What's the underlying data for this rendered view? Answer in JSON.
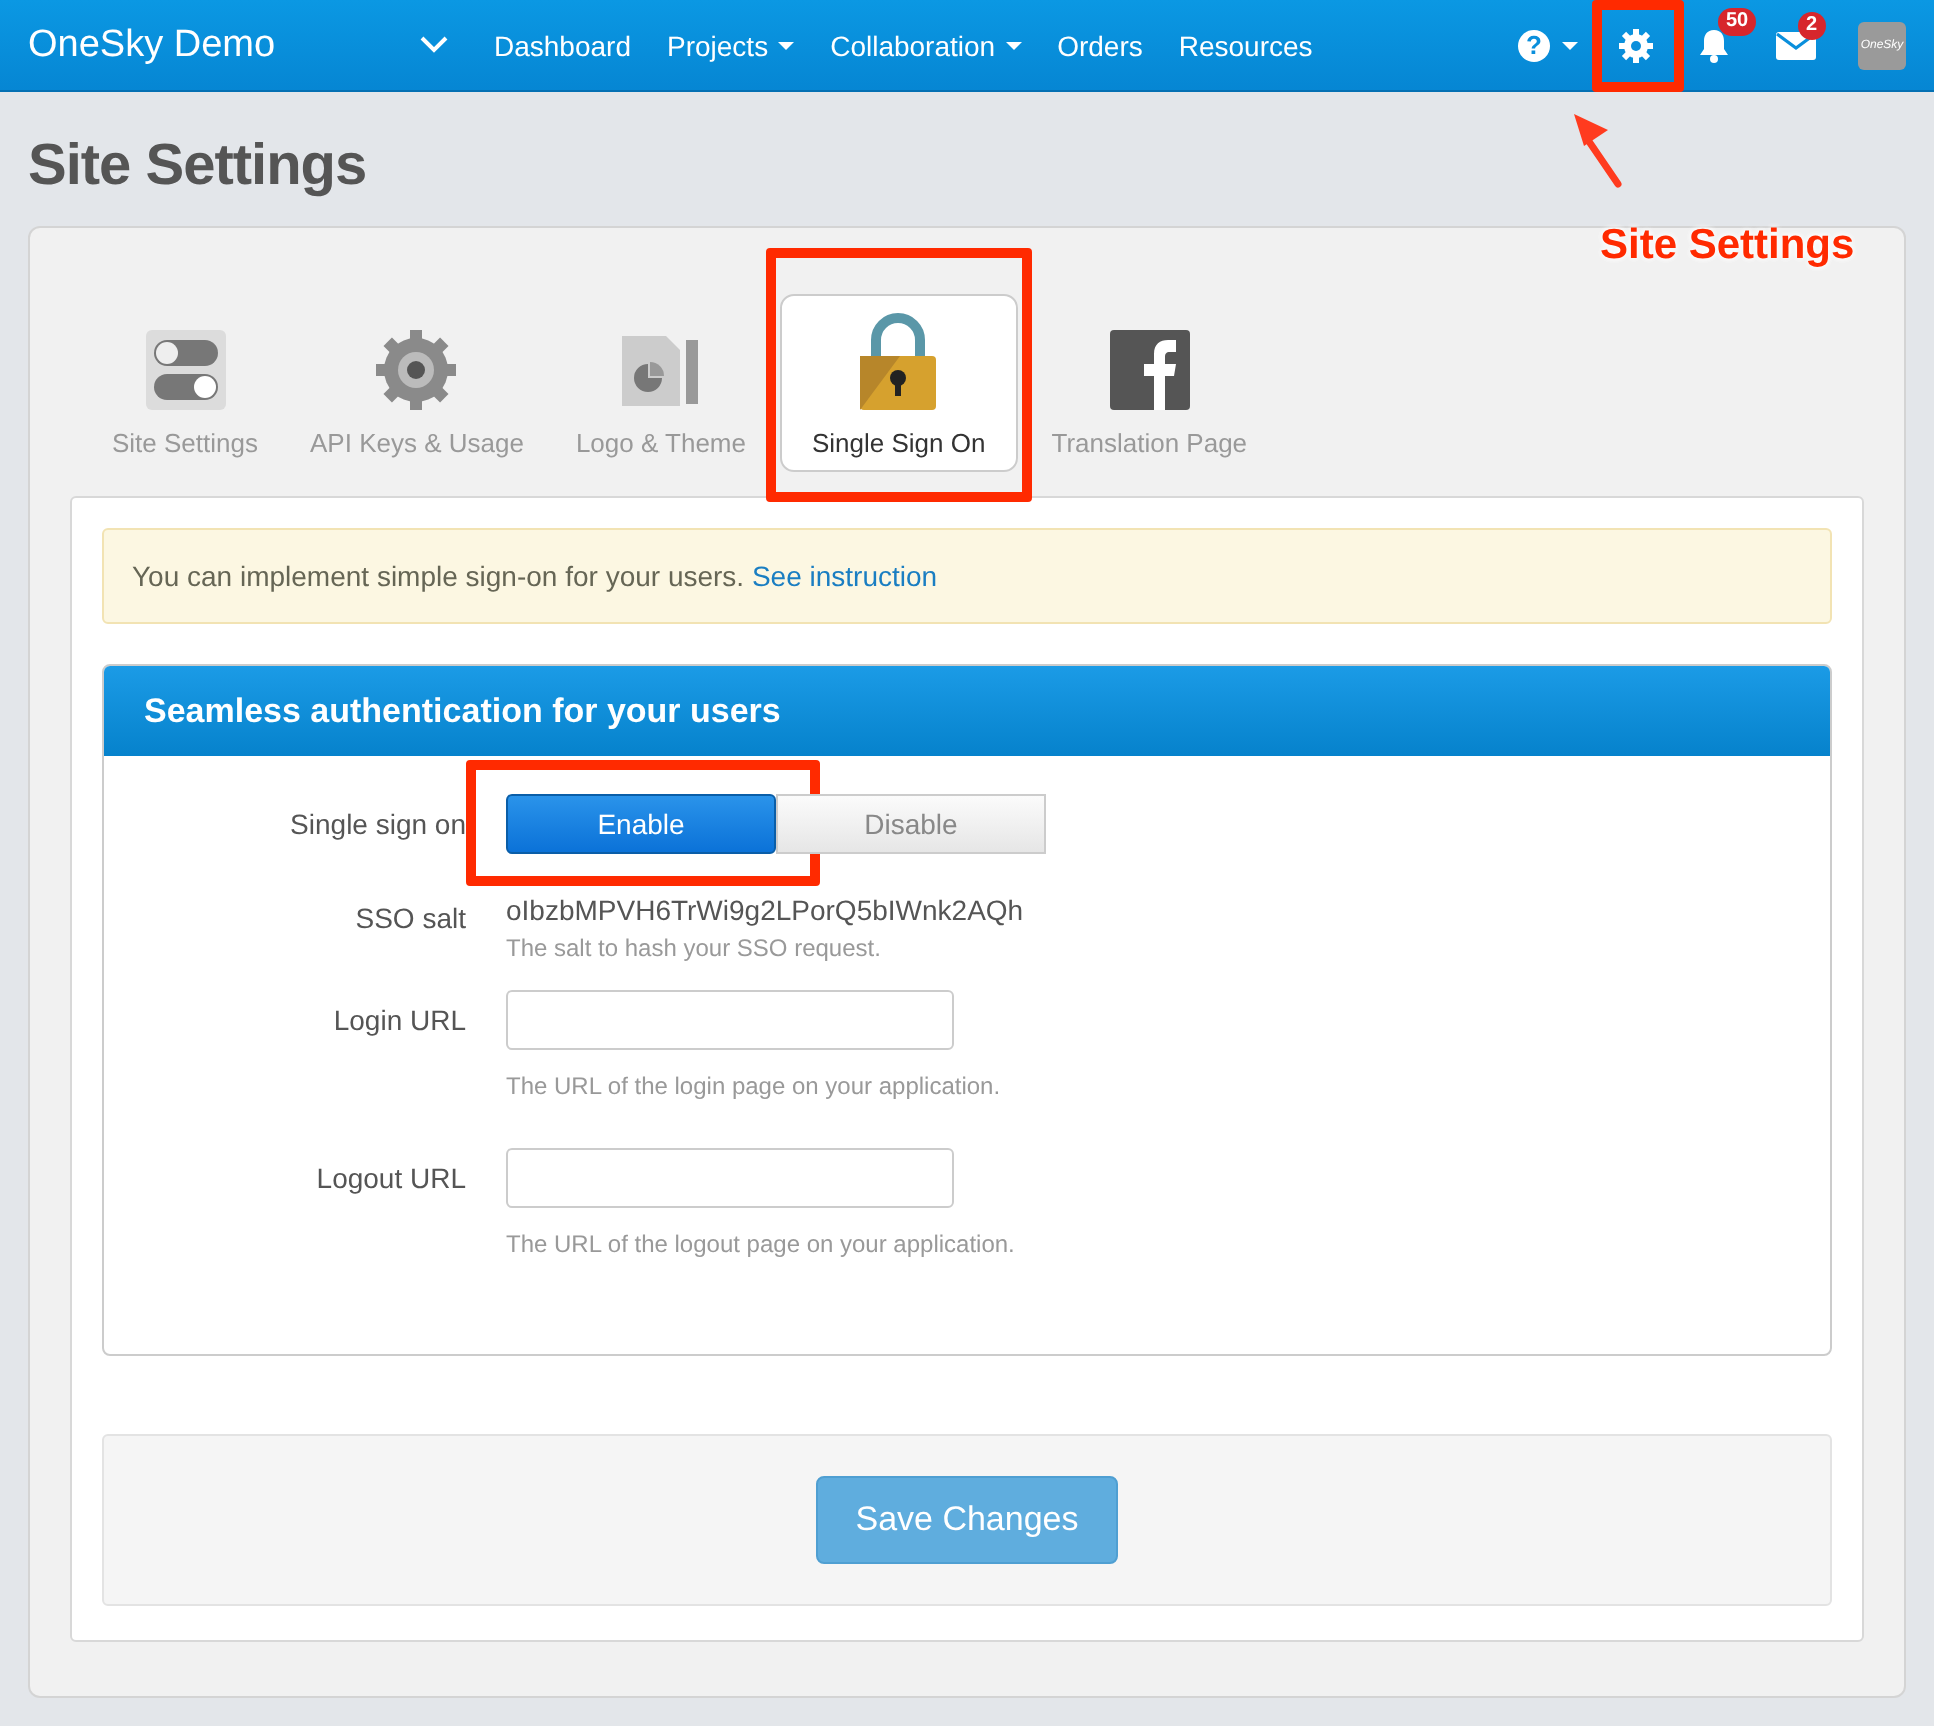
{
  "navbar": {
    "brand": "OneSky Demo",
    "menu": [
      {
        "label": "Dashboard",
        "has_caret": false
      },
      {
        "label": "Projects",
        "has_caret": true
      },
      {
        "label": "Collaboration",
        "has_caret": true
      },
      {
        "label": "Orders",
        "has_caret": false
      },
      {
        "label": "Resources",
        "has_caret": false
      }
    ],
    "tools": [
      {
        "kind": "help",
        "glyph": "?",
        "highlighted": false
      },
      {
        "kind": "settings",
        "highlighted": true
      },
      {
        "kind": "bell",
        "badge": "50",
        "highlighted": false
      },
      {
        "kind": "mail",
        "badge": "2",
        "highlighted": false
      }
    ],
    "avatar": "OneSky"
  },
  "page_title": "Site Settings",
  "tabs": [
    {
      "label": "Site Settings",
      "kind": "toggles",
      "selected": false,
      "highlighted": false
    },
    {
      "label": "API Keys & Usage",
      "kind": "gear",
      "selected": false,
      "highlighted": false
    },
    {
      "label": "Logo & Theme",
      "kind": "document",
      "selected": false,
      "highlighted": false
    },
    {
      "label": "Single Sign On",
      "kind": "lock",
      "selected": true,
      "highlighted": true
    },
    {
      "label": "Translation Page",
      "kind": "facebook",
      "selected": false,
      "highlighted": false
    }
  ],
  "alert": {
    "text": "You can implement simple sign-on for your users.",
    "link": "See instruction"
  },
  "panel": {
    "title": "Seamless authentication for your users",
    "fields": [
      {
        "kind": "toggle",
        "label": "Single sign on",
        "options": [
          {
            "label": "Enable",
            "selected": true,
            "highlighted": true
          },
          {
            "label": "Disable",
            "selected": false,
            "highlighted": false
          }
        ]
      },
      {
        "kind": "text",
        "label": "SSO salt",
        "value": "oIbzbMPVH6TrWi9g2LPorQ5bIWnk2AQh",
        "help": "The salt to hash your SSO request."
      },
      {
        "kind": "input",
        "label": "Login URL",
        "help": "The URL of the login page on your application."
      },
      {
        "kind": "input",
        "label": "Logout URL",
        "help": "The URL of the logout page on your application."
      }
    ]
  },
  "save_button": "Save Changes",
  "annotation": "Site Settings"
}
